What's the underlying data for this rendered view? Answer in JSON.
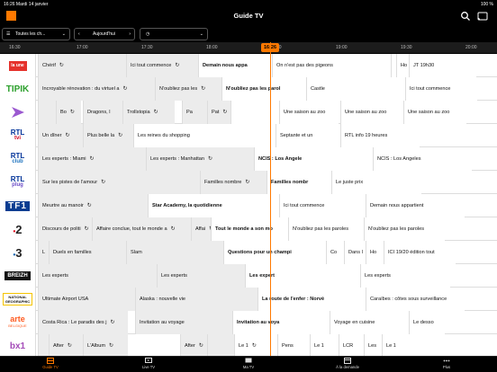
{
  "status": {
    "time": "16:26",
    "date": "Mardi 14 janvier",
    "battery": "100 %"
  },
  "header": {
    "title": "Guide TV"
  },
  "filters": {
    "channels": "Toutes les ch...",
    "day": "Aujourd'hui",
    "time": "16:26"
  },
  "timeline": {
    "ticks": [
      "16:30",
      "17:00",
      "17:30",
      "18:00",
      "18:30",
      "19:00",
      "19:30",
      "20:00"
    ],
    "now": "16:26"
  },
  "channels": [
    {
      "name": "La Une",
      "programs": [
        "Chérif",
        "Ici tout commence",
        "Demain nous appa",
        "On n'est pas des pigeons",
        "",
        "Ho",
        "JT 19h30"
      ]
    },
    {
      "name": "Tipik",
      "programs": [
        "Incroyable rénovation : du virtuel a",
        "N'oubliez pas les",
        "N'oubliez pas les parol",
        "Castle",
        "Ici tout commence"
      ]
    },
    {
      "name": "La Trois",
      "programs": [
        "",
        "Bo",
        "Dragons, l",
        "Trollstopia",
        "Pa",
        "Pat",
        "",
        "Une saison au zoo",
        "Une saison au zoo",
        "Une saison au zoo"
      ]
    },
    {
      "name": "RTL tvi",
      "programs": [
        "Un dîner",
        "Plus belle la",
        "Les reines du shopping",
        "Septante et un",
        "RTL info 19 heures"
      ]
    },
    {
      "name": "RTL club",
      "programs": [
        "Les experts : Miami",
        "Les experts : Manhattan",
        "NCIS : Los Angele",
        "NCIS : Los Angeles"
      ]
    },
    {
      "name": "RTL plug",
      "programs": [
        "Sur les pistes de l'amour",
        "Familles nombre",
        "Familles nombr",
        "Le juste prix"
      ]
    },
    {
      "name": "TF1",
      "programs": [
        "Meurtre au manoir",
        "Star Academy, la quotidienne",
        "Ici tout commence",
        "Demain nous appartient"
      ]
    },
    {
      "name": "France 2",
      "programs": [
        "Discours de politi",
        "Affaire conclue, tout le monde a",
        "Affai",
        "Tout le monde a son mo",
        "N'oubliez pas les paroles",
        "N'oubliez pas les paroles"
      ]
    },
    {
      "name": "France 3",
      "programs": [
        "L",
        "Duels en familles",
        "Slam",
        "Questions pour un champi",
        "Co",
        "Dans l",
        "Ho",
        "ICI 19/20 édition tout"
      ]
    },
    {
      "name": "Breizh",
      "programs": [
        "Les experts",
        "Les experts",
        "Les expert",
        "Les experts"
      ]
    },
    {
      "name": "National Geographic",
      "programs": [
        "Ultimate Airport USA",
        "Alaska : nouvelle vie",
        "La route de l'enfer : Norvè",
        "Caraïbes : côtes sous surveillance"
      ]
    },
    {
      "name": "Arte Belgique",
      "programs": [
        "Costa Rica : Le paradis des j",
        "Invitation au voyage",
        "Invitation au voya",
        "Voyage en cuisine",
        "Le desso"
      ]
    },
    {
      "name": "BX1",
      "programs": [
        "",
        "After",
        "L'Album",
        "After",
        "",
        "Le 1",
        "Pens",
        "Le 1",
        "LCR",
        "Les",
        "Le 1"
      ]
    }
  ],
  "tabs": [
    "Guide TV",
    "Live TV",
    "Ma TV",
    "À la demande",
    "Plus"
  ],
  "colors": {
    "accent": "#ff7900"
  }
}
